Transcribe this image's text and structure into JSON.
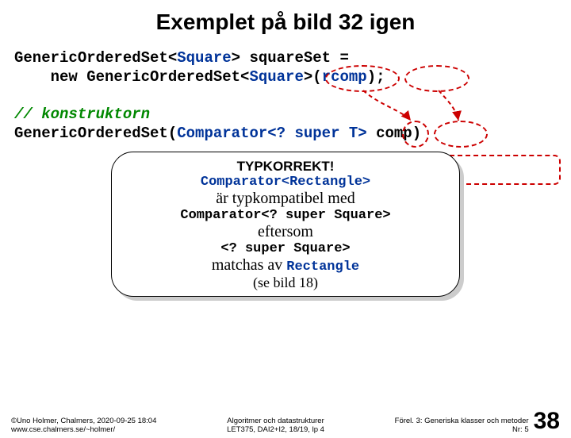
{
  "title": "Exemplet på bild 32 igen",
  "code": {
    "l1a": "GenericOrderedSet<",
    "l1b": "Square",
    "l1c": "> squareSet =",
    "l2a": "    new GenericOrderedSet<",
    "l2b": "Square",
    "l2c": ">(",
    "l2d": "rcomp",
    "l2e": ");",
    "blank": " ",
    "l3": "// konstruktorn",
    "l4a": "GenericOrderedSet(",
    "l4b": "Comparator<? super T>",
    "l4c": " comp)"
  },
  "explain": {
    "h1": "TYPKORREKT!",
    "h2": "Comparator<Rectangle>",
    "t1": "är typkompatibel med",
    "h3": "Comparator<? super Square>",
    "t2": "eftersom",
    "h4": "<? super Square>",
    "t3a": "matchas av ",
    "h5": "Rectangle",
    "t4": "(se bild 18)"
  },
  "footer": {
    "left1": "©Uno Holmer, Chalmers, 2020-09-25 18:04",
    "left2": "www.cse.chalmers.se/~holmer/",
    "mid1": "Algoritmer och datastrukturer",
    "mid2": "LET375, DAI2+I2, 18/19, lp 4",
    "right1": "Förel. 3: Generiska klasser och metoder",
    "right2": "Nr: 5",
    "page": "38"
  }
}
